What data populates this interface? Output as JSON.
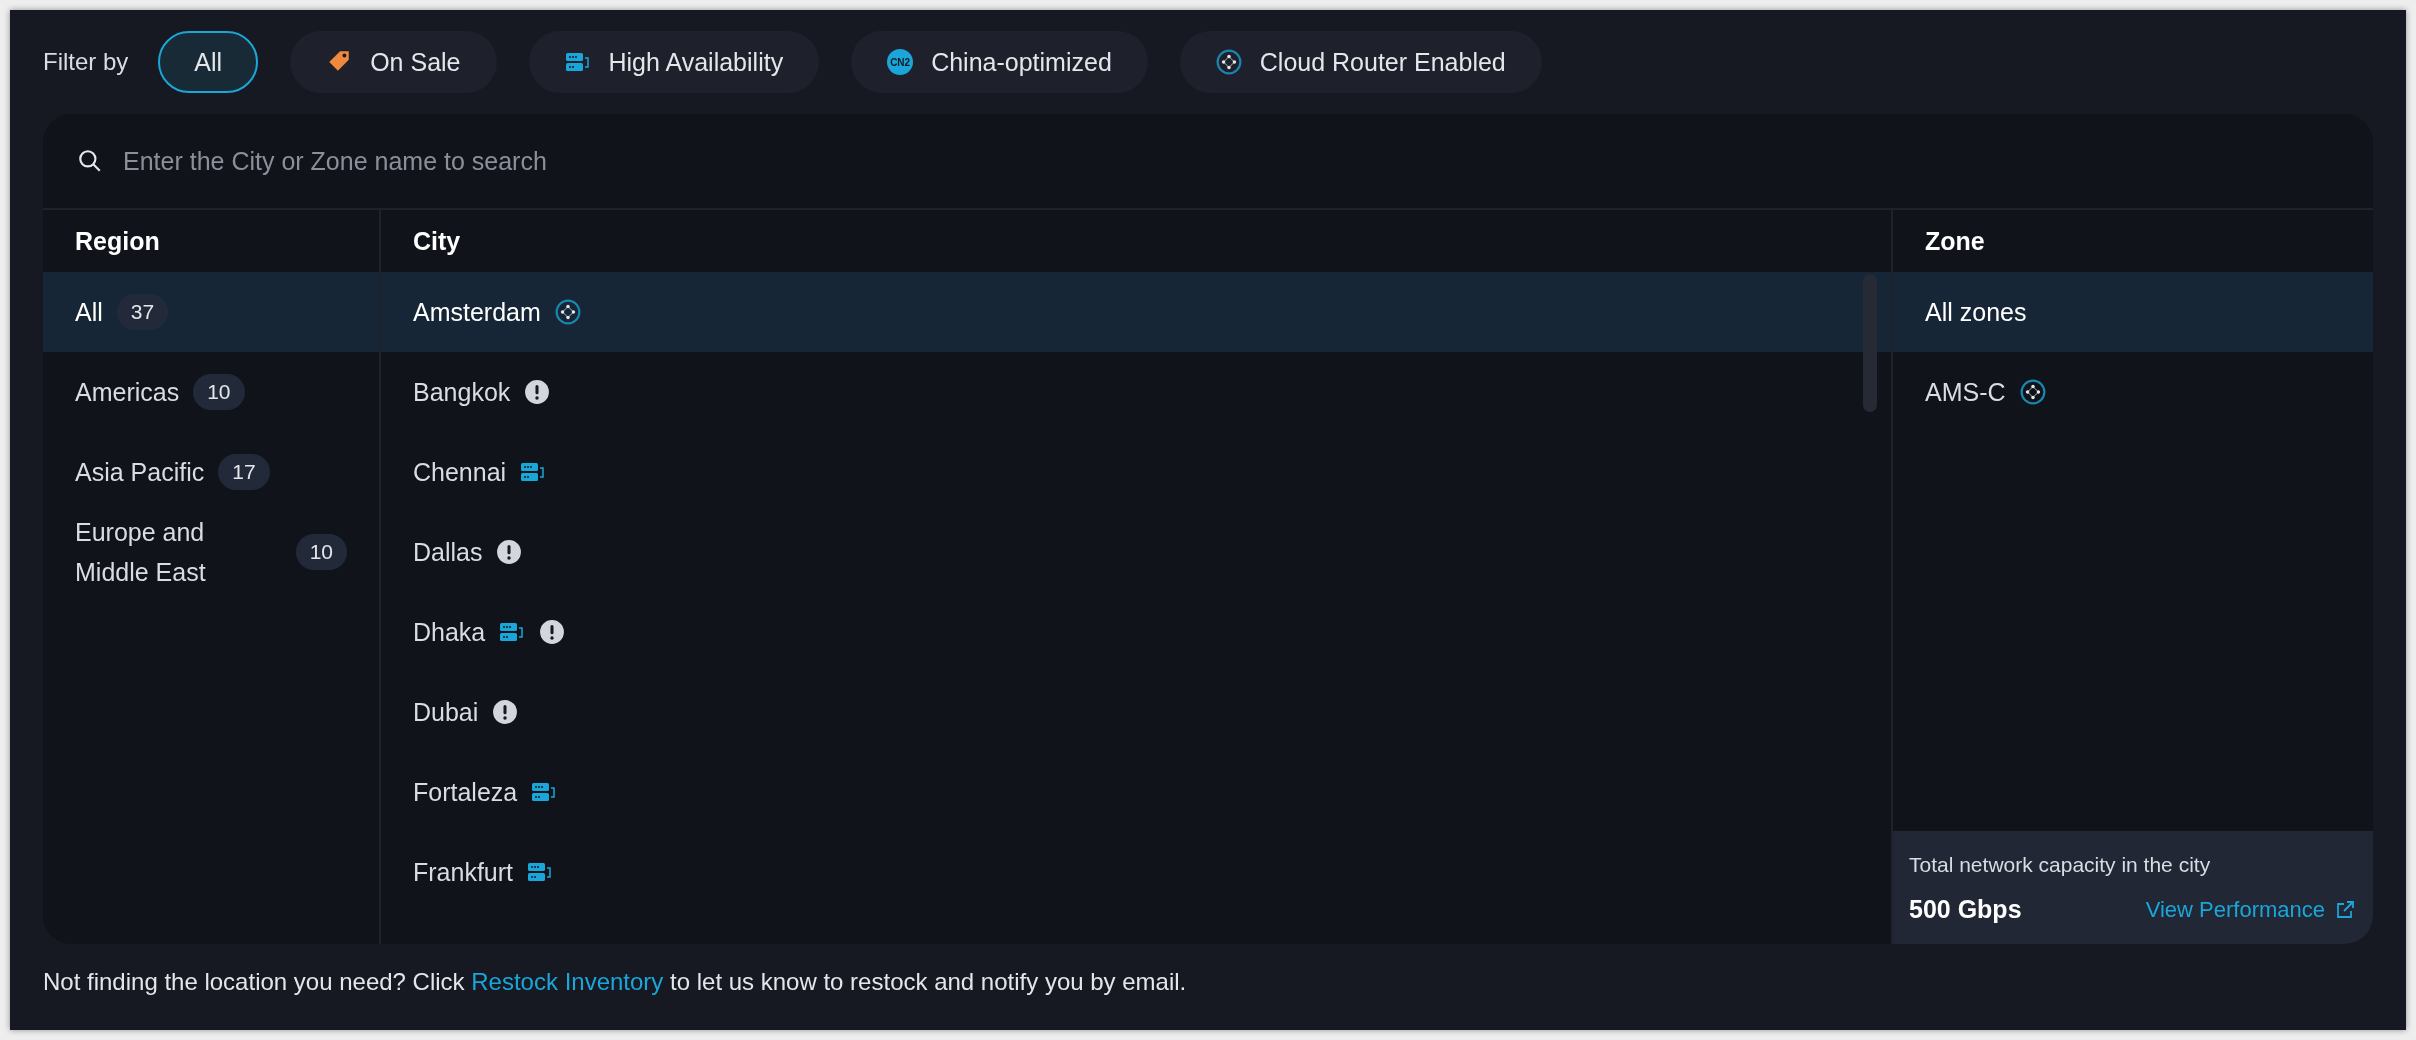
{
  "filter_bar": {
    "label": "Filter by",
    "filters": [
      {
        "label": "All",
        "selected": true
      },
      {
        "label": "On Sale",
        "selected": false,
        "kind": "sale"
      },
      {
        "label": "High Availability",
        "selected": false,
        "kind": "ha"
      },
      {
        "label": "China-optimized",
        "selected": false,
        "kind": "cn2",
        "icon_text": "CN2"
      },
      {
        "label": "Cloud Router Enabled",
        "selected": false,
        "kind": "router"
      }
    ]
  },
  "search": {
    "placeholder": "Enter the City or Zone name to search"
  },
  "region_column": {
    "heading": "Region",
    "items": [
      {
        "name": "All",
        "count": "37",
        "selected": true
      },
      {
        "name": "Americas",
        "count": "10",
        "selected": false
      },
      {
        "name": "Asia Pacific",
        "count": "17",
        "selected": false
      },
      {
        "name": "Europe and Middle East",
        "count": "10",
        "selected": false
      }
    ]
  },
  "city_column": {
    "heading": "City",
    "items": [
      {
        "name": "Amsterdam",
        "selected": true,
        "badges": [
          {
            "kind": "router"
          }
        ]
      },
      {
        "name": "Bangkok",
        "selected": false,
        "badges": [
          {
            "kind": "alert"
          }
        ]
      },
      {
        "name": "Chennai",
        "selected": false,
        "badges": [
          {
            "kind": "ha"
          }
        ]
      },
      {
        "name": "Dallas",
        "selected": false,
        "badges": [
          {
            "kind": "alert"
          }
        ]
      },
      {
        "name": "Dhaka",
        "selected": false,
        "badges": [
          {
            "kind": "ha"
          },
          {
            "kind": "alert"
          }
        ]
      },
      {
        "name": "Dubai",
        "selected": false,
        "badges": [
          {
            "kind": "alert"
          }
        ]
      },
      {
        "name": "Fortaleza",
        "selected": false,
        "badges": [
          {
            "kind": "ha"
          }
        ]
      },
      {
        "name": "Frankfurt",
        "selected": false,
        "badges": [
          {
            "kind": "ha"
          }
        ]
      }
    ]
  },
  "zone_column": {
    "heading": "Zone",
    "items": [
      {
        "name": "All zones",
        "selected": true
      },
      {
        "name": "AMS-C",
        "selected": false,
        "badges": [
          {
            "kind": "router"
          }
        ]
      }
    ],
    "capacity": {
      "label": "Total network capacity in the city",
      "value": "500 Gbps",
      "link": "View Performance"
    }
  },
  "footer": {
    "before": "Not finding the location you need? Click ",
    "link": "Restock Inventory",
    "after": " to let us know to restock and notify you by email."
  }
}
